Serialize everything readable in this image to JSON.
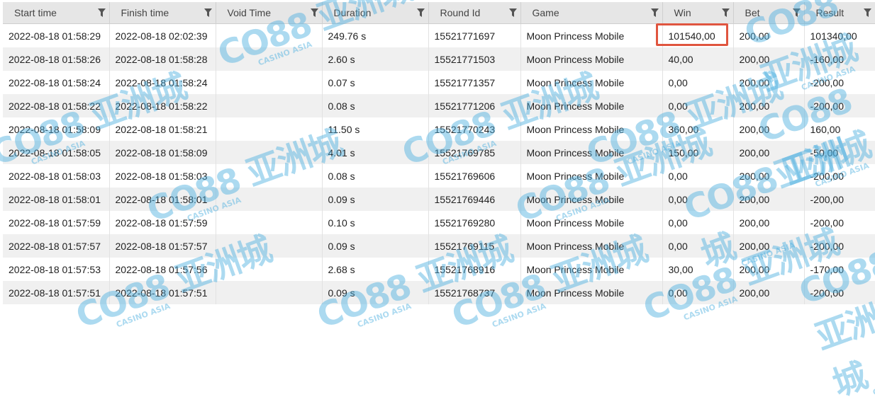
{
  "columns": [
    {
      "label": "Start time"
    },
    {
      "label": "Finish time"
    },
    {
      "label": "Void Time"
    },
    {
      "label": "Duration"
    },
    {
      "label": "Round Id"
    },
    {
      "label": "Game"
    },
    {
      "label": "Win"
    },
    {
      "label": "Bet"
    },
    {
      "label": "Result"
    }
  ],
  "rows": [
    {
      "start": "2022-08-18 01:58:29",
      "finish": "2022-08-18 02:02:39",
      "void": "",
      "duration": "249.76 s",
      "round_id": "15521771697",
      "game": "Moon Princess Mobile",
      "win": "101540,00",
      "bet": "200,00",
      "result": "101340,00"
    },
    {
      "start": "2022-08-18 01:58:26",
      "finish": "2022-08-18 01:58:28",
      "void": "",
      "duration": "2.60 s",
      "round_id": "15521771503",
      "game": "Moon Princess Mobile",
      "win": "40,00",
      "bet": "200,00",
      "result": "-160,00"
    },
    {
      "start": "2022-08-18 01:58:24",
      "finish": "2022-08-18 01:58:24",
      "void": "",
      "duration": "0.07 s",
      "round_id": "15521771357",
      "game": "Moon Princess Mobile",
      "win": "0,00",
      "bet": "200,00",
      "result": "-200,00"
    },
    {
      "start": "2022-08-18 01:58:22",
      "finish": "2022-08-18 01:58:22",
      "void": "",
      "duration": "0.08 s",
      "round_id": "15521771206",
      "game": "Moon Princess Mobile",
      "win": "0,00",
      "bet": "200,00",
      "result": "-200,00"
    },
    {
      "start": "2022-08-18 01:58:09",
      "finish": "2022-08-18 01:58:21",
      "void": "",
      "duration": "11.50 s",
      "round_id": "15521770243",
      "game": "Moon Princess Mobile",
      "win": "360,00",
      "bet": "200,00",
      "result": "160,00"
    },
    {
      "start": "2022-08-18 01:58:05",
      "finish": "2022-08-18 01:58:09",
      "void": "",
      "duration": "4.01 s",
      "round_id": "15521769785",
      "game": "Moon Princess Mobile",
      "win": "150,00",
      "bet": "200,00",
      "result": "-50,00"
    },
    {
      "start": "2022-08-18 01:58:03",
      "finish": "2022-08-18 01:58:03",
      "void": "",
      "duration": "0.08 s",
      "round_id": "15521769606",
      "game": "Moon Princess Mobile",
      "win": "0,00",
      "bet": "200,00",
      "result": "-200,00"
    },
    {
      "start": "2022-08-18 01:58:01",
      "finish": "2022-08-18 01:58:01",
      "void": "",
      "duration": "0.09 s",
      "round_id": "15521769446",
      "game": "Moon Princess Mobile",
      "win": "0,00",
      "bet": "200,00",
      "result": "-200,00"
    },
    {
      "start": "2022-08-18 01:57:59",
      "finish": "2022-08-18 01:57:59",
      "void": "",
      "duration": "0.10 s",
      "round_id": "15521769280",
      "game": "Moon Princess Mobile",
      "win": "0,00",
      "bet": "200,00",
      "result": "-200,00"
    },
    {
      "start": "2022-08-18 01:57:57",
      "finish": "2022-08-18 01:57:57",
      "void": "",
      "duration": "0.09 s",
      "round_id": "15521769115",
      "game": "Moon Princess Mobile",
      "win": "0,00",
      "bet": "200,00",
      "result": "-200,00"
    },
    {
      "start": "2022-08-18 01:57:53",
      "finish": "2022-08-18 01:57:56",
      "void": "",
      "duration": "2.68 s",
      "round_id": "15521768916",
      "game": "Moon Princess Mobile",
      "win": "30,00",
      "bet": "200,00",
      "result": "-170,00"
    },
    {
      "start": "2022-08-18 01:57:51",
      "finish": "2022-08-18 01:57:51",
      "void": "",
      "duration": "0.09 s",
      "round_id": "15521768737",
      "game": "Moon Princess Mobile",
      "win": "0,00",
      "bet": "200,00",
      "result": "-200,00"
    }
  ],
  "watermark": {
    "brand": "CO88",
    "cn": "亚洲城",
    "sub": "CASINO ASIA"
  },
  "colors": {
    "highlight": "#e0553f",
    "watermark": "#4aaee0",
    "header_bg": "#e6e6e6",
    "row_alt": "#f0f0f0"
  }
}
